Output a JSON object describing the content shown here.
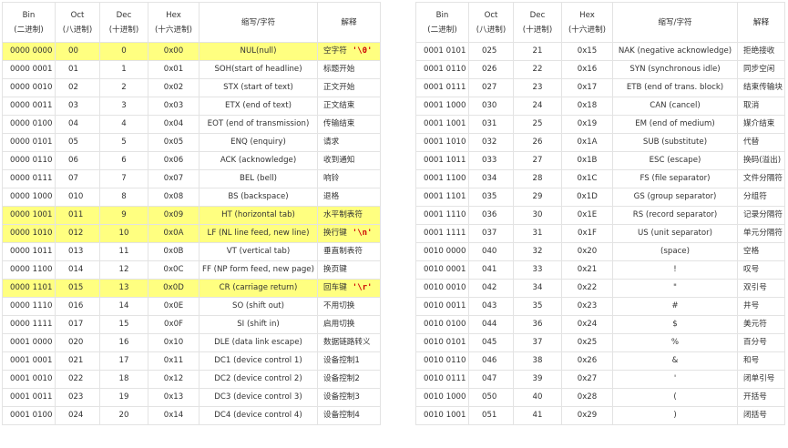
{
  "headers": {
    "bin": "Bin",
    "bin_sub": "(二进制)",
    "oct": "Oct",
    "oct_sub": "(八进制)",
    "dec": "Dec",
    "dec_sub": "(十进制)",
    "hex": "Hex",
    "hex_sub": "(十六进制)",
    "desc": "缩写/字符",
    "explain": "解释"
  },
  "left_rows": [
    {
      "bin": "0000 0000",
      "oct": "00",
      "dec": "0",
      "hex": "0x00",
      "desc": "NUL(null)",
      "explain": "空字符",
      "escape": "'\\0'",
      "highlight": true
    },
    {
      "bin": "0000 0001",
      "oct": "01",
      "dec": "1",
      "hex": "0x01",
      "desc": "SOH(start of headline)",
      "explain": "标题开始"
    },
    {
      "bin": "0000 0010",
      "oct": "02",
      "dec": "2",
      "hex": "0x02",
      "desc": "STX (start of text)",
      "explain": "正文开始"
    },
    {
      "bin": "0000 0011",
      "oct": "03",
      "dec": "3",
      "hex": "0x03",
      "desc": "ETX (end of text)",
      "explain": "正文结束"
    },
    {
      "bin": "0000 0100",
      "oct": "04",
      "dec": "4",
      "hex": "0x04",
      "desc": "EOT (end of transmission)",
      "explain": "传输结束"
    },
    {
      "bin": "0000 0101",
      "oct": "05",
      "dec": "5",
      "hex": "0x05",
      "desc": "ENQ (enquiry)",
      "explain": "请求"
    },
    {
      "bin": "0000 0110",
      "oct": "06",
      "dec": "6",
      "hex": "0x06",
      "desc": "ACK (acknowledge)",
      "explain": "收到通知"
    },
    {
      "bin": "0000 0111",
      "oct": "07",
      "dec": "7",
      "hex": "0x07",
      "desc": "BEL (bell)",
      "explain": "响铃"
    },
    {
      "bin": "0000 1000",
      "oct": "010",
      "dec": "8",
      "hex": "0x08",
      "desc": "BS (backspace)",
      "explain": "退格"
    },
    {
      "bin": "0000 1001",
      "oct": "011",
      "dec": "9",
      "hex": "0x09",
      "desc": "HT (horizontal tab)",
      "explain": "水平制表符",
      "highlight": true
    },
    {
      "bin": "0000 1010",
      "oct": "012",
      "dec": "10",
      "hex": "0x0A",
      "desc": "LF (NL line feed, new line)",
      "explain": "换行键",
      "escape": "'\\n'",
      "highlight": true
    },
    {
      "bin": "0000 1011",
      "oct": "013",
      "dec": "11",
      "hex": "0x0B",
      "desc": "VT (vertical tab)",
      "explain": "垂直制表符"
    },
    {
      "bin": "0000 1100",
      "oct": "014",
      "dec": "12",
      "hex": "0x0C",
      "desc": "FF (NP form feed, new page)",
      "explain": "换页键"
    },
    {
      "bin": "0000 1101",
      "oct": "015",
      "dec": "13",
      "hex": "0x0D",
      "desc": "CR (carriage return)",
      "explain": "回车键",
      "escape": "'\\r'",
      "highlight": true
    },
    {
      "bin": "0000 1110",
      "oct": "016",
      "dec": "14",
      "hex": "0x0E",
      "desc": "SO (shift out)",
      "explain": "不用切换"
    },
    {
      "bin": "0000 1111",
      "oct": "017",
      "dec": "15",
      "hex": "0x0F",
      "desc": "SI (shift in)",
      "explain": "启用切换"
    },
    {
      "bin": "0001 0000",
      "oct": "020",
      "dec": "16",
      "hex": "0x10",
      "desc": "DLE (data link escape)",
      "explain": "数据链路转义"
    },
    {
      "bin": "0001 0001",
      "oct": "021",
      "dec": "17",
      "hex": "0x11",
      "desc": "DC1 (device control 1)",
      "explain": "设备控制1"
    },
    {
      "bin": "0001 0010",
      "oct": "022",
      "dec": "18",
      "hex": "0x12",
      "desc": "DC2 (device control 2)",
      "explain": "设备控制2"
    },
    {
      "bin": "0001 0011",
      "oct": "023",
      "dec": "19",
      "hex": "0x13",
      "desc": "DC3 (device control 3)",
      "explain": "设备控制3"
    },
    {
      "bin": "0001 0100",
      "oct": "024",
      "dec": "20",
      "hex": "0x14",
      "desc": "DC4 (device control 4)",
      "explain": "设备控制4"
    }
  ],
  "right_rows": [
    {
      "bin": "0001 0101",
      "oct": "025",
      "dec": "21",
      "hex": "0x15",
      "desc": "NAK (negative acknowledge)",
      "explain": "拒绝接收"
    },
    {
      "bin": "0001 0110",
      "oct": "026",
      "dec": "22",
      "hex": "0x16",
      "desc": "SYN (synchronous idle)",
      "explain": "同步空闲"
    },
    {
      "bin": "0001 0111",
      "oct": "027",
      "dec": "23",
      "hex": "0x17",
      "desc": "ETB (end of trans. block)",
      "explain": "结束传输块"
    },
    {
      "bin": "0001 1000",
      "oct": "030",
      "dec": "24",
      "hex": "0x18",
      "desc": "CAN (cancel)",
      "explain": "取消"
    },
    {
      "bin": "0001 1001",
      "oct": "031",
      "dec": "25",
      "hex": "0x19",
      "desc": "EM (end of medium)",
      "explain": "媒介结束"
    },
    {
      "bin": "0001 1010",
      "oct": "032",
      "dec": "26",
      "hex": "0x1A",
      "desc": "SUB (substitute)",
      "explain": "代替"
    },
    {
      "bin": "0001 1011",
      "oct": "033",
      "dec": "27",
      "hex": "0x1B",
      "desc": "ESC (escape)",
      "explain": "换码(溢出)"
    },
    {
      "bin": "0001 1100",
      "oct": "034",
      "dec": "28",
      "hex": "0x1C",
      "desc": "FS (file separator)",
      "explain": "文件分隔符"
    },
    {
      "bin": "0001 1101",
      "oct": "035",
      "dec": "29",
      "hex": "0x1D",
      "desc": "GS (group separator)",
      "explain": "分组符"
    },
    {
      "bin": "0001 1110",
      "oct": "036",
      "dec": "30",
      "hex": "0x1E",
      "desc": "RS (record separator)",
      "explain": "记录分隔符"
    },
    {
      "bin": "0001 1111",
      "oct": "037",
      "dec": "31",
      "hex": "0x1F",
      "desc": "US (unit separator)",
      "explain": "单元分隔符"
    },
    {
      "bin": "0010 0000",
      "oct": "040",
      "dec": "32",
      "hex": "0x20",
      "desc": "(space)",
      "explain": "空格"
    },
    {
      "bin": "0010 0001",
      "oct": "041",
      "dec": "33",
      "hex": "0x21",
      "desc": "!",
      "explain": "叹号"
    },
    {
      "bin": "0010 0010",
      "oct": "042",
      "dec": "34",
      "hex": "0x22",
      "desc": "\"",
      "explain": "双引号"
    },
    {
      "bin": "0010 0011",
      "oct": "043",
      "dec": "35",
      "hex": "0x23",
      "desc": "#",
      "explain": "井号"
    },
    {
      "bin": "0010 0100",
      "oct": "044",
      "dec": "36",
      "hex": "0x24",
      "desc": "$",
      "explain": "美元符"
    },
    {
      "bin": "0010 0101",
      "oct": "045",
      "dec": "37",
      "hex": "0x25",
      "desc": "%",
      "explain": "百分号"
    },
    {
      "bin": "0010 0110",
      "oct": "046",
      "dec": "38",
      "hex": "0x26",
      "desc": "&",
      "explain": "和号"
    },
    {
      "bin": "0010 0111",
      "oct": "047",
      "dec": "39",
      "hex": "0x27",
      "desc": "'",
      "explain": "闭单引号"
    },
    {
      "bin": "0010 1000",
      "oct": "050",
      "dec": "40",
      "hex": "0x28",
      "desc": "(",
      "explain": "开括号"
    },
    {
      "bin": "0010 1001",
      "oct": "051",
      "dec": "41",
      "hex": "0x29",
      "desc": ")",
      "explain": "闭括号"
    }
  ]
}
